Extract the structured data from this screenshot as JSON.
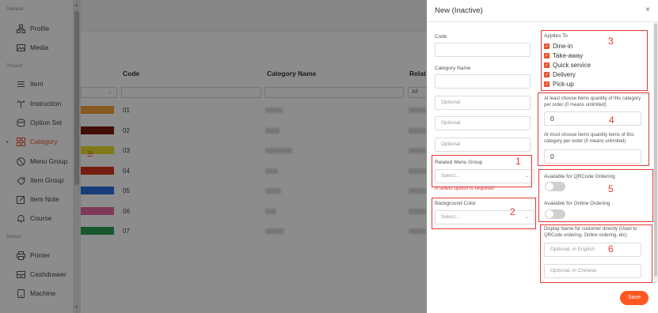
{
  "sidebar": {
    "sections": [
      {
        "title": "General",
        "items": [
          {
            "label": "Profile",
            "icon": "profile-icon"
          },
          {
            "label": "Media",
            "icon": "media-icon"
          }
        ]
      },
      {
        "title": "Product",
        "items": [
          {
            "label": "Item",
            "icon": "item-icon"
          },
          {
            "label": "Instruction",
            "icon": "instruction-icon"
          },
          {
            "label": "Option Set",
            "icon": "option-set-icon"
          },
          {
            "label": "Category",
            "icon": "category-icon",
            "active": true
          },
          {
            "label": "Menu Group",
            "icon": "menu-group-icon"
          },
          {
            "label": "Item Group",
            "icon": "item-group-icon"
          },
          {
            "label": "Item Note",
            "icon": "item-note-icon"
          },
          {
            "label": "Course",
            "icon": "course-icon"
          }
        ]
      },
      {
        "title": "Device",
        "items": [
          {
            "label": "Printer",
            "icon": "printer-icon"
          },
          {
            "label": "Cashdrawer",
            "icon": "cashdrawer-icon"
          },
          {
            "label": "Machine",
            "icon": "machine-icon"
          }
        ]
      }
    ]
  },
  "table": {
    "headers": {
      "code": "Code",
      "category_name": "Category Name",
      "related": "Relat"
    },
    "filter_all": "All",
    "rows": [
      {
        "code": "01",
        "color": "#f2a33a"
      },
      {
        "code": "02",
        "color": "#7a1a0c"
      },
      {
        "code": "03",
        "color": "#e8df2a"
      },
      {
        "code": "04",
        "color": "#d9361c"
      },
      {
        "code": "05",
        "color": "#2f6fe0"
      },
      {
        "code": "06",
        "color": "#e86aa3"
      },
      {
        "code": "07",
        "color": "#2aa05a"
      }
    ]
  },
  "modal": {
    "title": "New (Inactive)",
    "close": "×",
    "code_label": "Code",
    "code_value": "",
    "category_name_label": "Category Name",
    "category_name_value": "",
    "optional_1": "Optional",
    "optional_2": "Optional",
    "optional_3": "Optional",
    "related_menu_group_label": "Related Menu Group",
    "related_menu_group_placeholder": "Select...",
    "related_menu_group_error": "A select option is required",
    "background_color_label": "Background Color",
    "background_color_placeholder": "Select...",
    "applies_to_label": "Applies To",
    "applies_to_options": [
      {
        "label": "Dine-in",
        "checked": true
      },
      {
        "label": "Take-away",
        "checked": true
      },
      {
        "label": "Quick service",
        "checked": true
      },
      {
        "label": "Delivery",
        "checked": true
      },
      {
        "label": "Pick-up",
        "checked": true
      }
    ],
    "at_least_label": "At least choose items quantity of this category per order (0 means unlimited)",
    "at_least_value": "0",
    "at_most_label": "At most choose items quantity items of this category per order (0 means unlimited)",
    "at_most_value": "0",
    "qrcode_label": "Available for QRCode Ordering",
    "qrcode_enabled": false,
    "online_label": "Available for Online Ordering",
    "online_enabled": false,
    "display_name_label": "Display Name for customer directly (Used to QRCode ordering, Online ordering, etc)",
    "display_name_english_placeholder": "Optional, in English",
    "display_name_chinese_placeholder": "Optional, in Chinese",
    "save_label": "Save"
  },
  "annotations": [
    "1",
    "2",
    "3",
    "4",
    "5",
    "6"
  ],
  "colors": {
    "accent": "#e8502a",
    "save": "#ff5722",
    "annotation": "#e53935"
  }
}
